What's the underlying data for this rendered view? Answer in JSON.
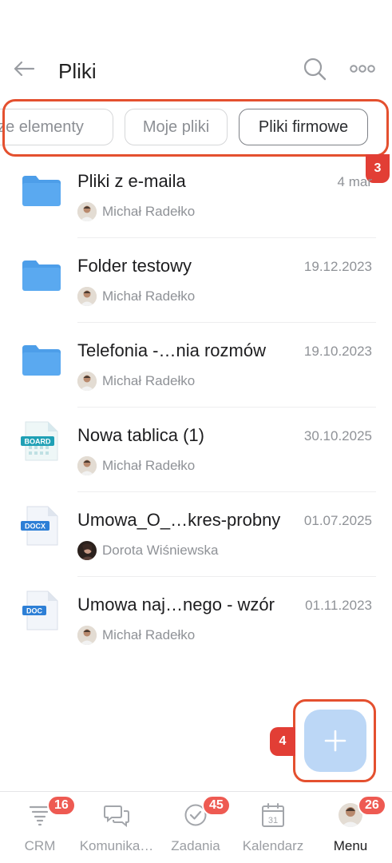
{
  "header": {
    "title": "Pliki"
  },
  "chips": [
    {
      "label": "ze elementy",
      "selected": false
    },
    {
      "label": "Moje pliki",
      "selected": false
    },
    {
      "label": "Pliki firmowe",
      "selected": true
    }
  ],
  "callouts": {
    "chips_number": "3",
    "fab_number": "4",
    "color": "#e4502f"
  },
  "files": [
    {
      "name": "Pliki z e-maila",
      "date": "4 mar",
      "owner": "Michał Radełko",
      "icon": "folder-icon"
    },
    {
      "name": "Folder testowy",
      "date": "19.12.2023",
      "owner": "Michał Radełko",
      "icon": "folder-icon"
    },
    {
      "name": "Telefonia -…nia rozmów",
      "date": "19.10.2023",
      "owner": "Michał Radełko",
      "icon": "folder-icon"
    },
    {
      "name": "Nowa tablica (1)",
      "date": "30.10.2025",
      "owner": "Michał Radełko",
      "icon": "board-file-icon",
      "icon_label": "BOARD"
    },
    {
      "name": "Umowa_O_…kres-probny",
      "date": "01.07.2025",
      "owner": "Dorota Wiśniewska",
      "icon": "docx-file-icon",
      "icon_label": "DOCX"
    },
    {
      "name": "Umowa naj…nego - wzór",
      "date": "01.11.2023",
      "owner": "Michał Radełko",
      "icon": "doc-file-icon",
      "icon_label": "DOC"
    }
  ],
  "fab": {
    "symbol": "+",
    "color": "#bcd7f6"
  },
  "nav": [
    {
      "label": "CRM",
      "badge": "16",
      "icon": "crm-funnel-icon"
    },
    {
      "label": "Komunika…",
      "badge": "",
      "icon": "chat-bubbles-icon"
    },
    {
      "label": "Zadania",
      "badge": "45",
      "icon": "check-circle-icon"
    },
    {
      "label": "Kalendarz",
      "badge": "",
      "icon": "calendar-icon",
      "icon_text": "31"
    },
    {
      "label": "Menu",
      "badge": "26",
      "icon": "user-avatar-icon",
      "active": true
    }
  ],
  "colors": {
    "badge": "#ee5a52",
    "folder": "#5aa9f0",
    "accent_dark": "#2b2d30"
  }
}
